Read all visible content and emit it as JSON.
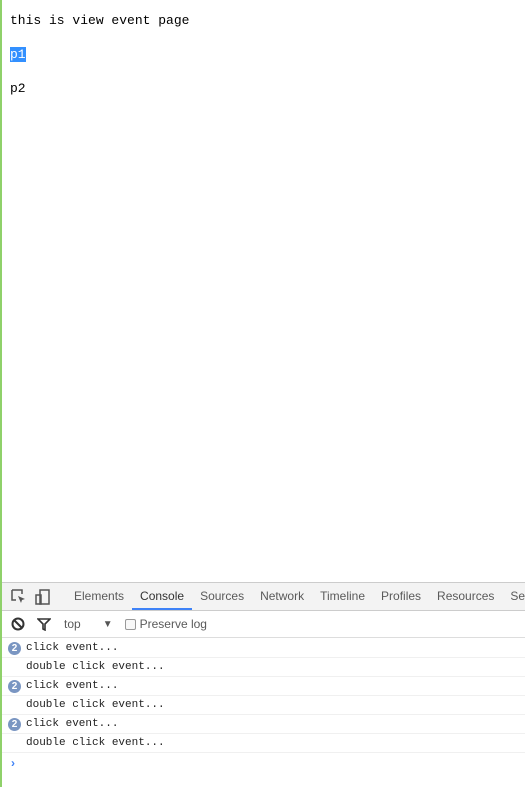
{
  "page": {
    "heading": "this is view event page",
    "p1": "p1",
    "p2": "p2"
  },
  "devtools": {
    "tabs": [
      "Elements",
      "Console",
      "Sources",
      "Network",
      "Timeline",
      "Profiles",
      "Resources",
      "Sec"
    ],
    "active_tab": "Console",
    "context": "top",
    "preserve_log": "Preserve log",
    "preserve_log_checked": false,
    "messages": [
      {
        "text": "click event...",
        "count": "2"
      },
      {
        "text": "double click event..."
      },
      {
        "text": "click event...",
        "count": "2"
      },
      {
        "text": "double click event..."
      },
      {
        "text": "click event...",
        "count": "2"
      },
      {
        "text": "double click event..."
      }
    ],
    "prompt": "›"
  }
}
